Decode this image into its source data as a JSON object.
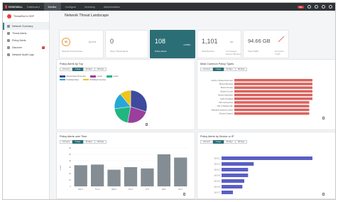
{
  "topbar": {
    "logo_text": "SONICWALL",
    "tabs": [
      {
        "label": "Dashboard",
        "active": false
      },
      {
        "label": "Monitor",
        "active": true
      },
      {
        "label": "Configure",
        "active": false
      },
      {
        "label": "Inventory",
        "active": false
      },
      {
        "label": "Administration",
        "active": false
      }
    ],
    "alert_count": "99+",
    "icons": [
      "bell-icon",
      "help-icon",
      "settings-icon",
      "user-icon"
    ]
  },
  "sidebar": {
    "header": "Threat/Bot in SDP",
    "items": [
      {
        "label": "Network Summary",
        "active": true,
        "icon": "summary-icon",
        "badge": ""
      },
      {
        "label": "Threat Alerts",
        "active": false,
        "icon": "alert-icon",
        "badge": ""
      },
      {
        "label": "Policy Alerts",
        "active": false,
        "icon": "policy-icon",
        "badge": ""
      },
      {
        "label": "Discover",
        "active": false,
        "icon": "discover-icon",
        "badge": "1"
      },
      {
        "label": "Network Audit Logs",
        "active": false,
        "icon": "logs-icon",
        "badge": ""
      }
    ]
  },
  "main": {
    "title": "Network Threat Landscape",
    "kpis": [
      {
        "value": "53",
        "label": "Network Threat Score",
        "trend": "-40.47%",
        "trend_label": "",
        "gauge": true,
        "selected": false
      },
      {
        "value": "0",
        "label": "Open Threat Alerts",
        "trend": "",
        "trend_label": "",
        "gauge": false,
        "selected": false
      },
      {
        "value": "108",
        "label": "Policy Alerts",
        "trend": "+9.85%",
        "trend_label": "",
        "gauge": false,
        "selected": true
      },
      {
        "value": "1,101",
        "label": "Total Devices",
        "trend": "0%",
        "trend_label": "Unmanaged Devices Blocked",
        "gauge": false,
        "selected": false
      },
      {
        "value": "94.66 GB",
        "label": "Total Traffic",
        "trend": "",
        "trend_label": "Encrypted Traffic",
        "gauge": false,
        "selected": false
      }
    ],
    "range_options": [
      "24 hours",
      "7 days",
      "30 days",
      "90 days"
    ],
    "range_selected": "7 days",
    "pie_panel": {
      "title": "Policy Alerts by Top",
      "legend": [
        {
          "name": "Ransomware Prevention",
          "color": "#3d4a9e"
        },
        {
          "name": "Level2",
          "color": "#9a3f9c"
        },
        {
          "name": "Level1",
          "color": "#23b57f"
        },
        {
          "name": "Prohibited Sites",
          "color": "#27a7d8"
        },
        {
          "name": "Prohibited Countries",
          "color": "#f0c419"
        }
      ],
      "slices": [
        {
          "name": "Ransomware Prevention",
          "value": 30,
          "color": "#3d4a9e"
        },
        {
          "name": "Level2",
          "value": 23,
          "color": "#9a3f9c"
        },
        {
          "name": "Level1",
          "value": 20,
          "color": "#23b57f"
        },
        {
          "name": "Prohibited Sites",
          "value": 16,
          "color": "#27a7d8"
        },
        {
          "name": "Prohibited Countries",
          "value": 11,
          "color": "#f0c419"
        }
      ]
    },
    "violations_panel": {
      "title": "Most Common Policy Types",
      "bar_color": "#d9645f",
      "categories": [
        "Activity in Bypass Mode Alert",
        "Blocked Browsing",
        "Blocked Service",
        "Blocked Country",
        "Blocked Application",
        "Traffic Prohibited",
        "P2P, Gaming Sites",
        "URL in Whitelist URL",
        "Application blocked by policy",
        "Blocked Category"
      ],
      "values": [
        98,
        98,
        98,
        98,
        98,
        98,
        94,
        94,
        94,
        94
      ]
    },
    "time_panel": {
      "title": "Policy Alerts over Time",
      "bar_color": "#858d94",
      "ylabel": "Count",
      "ylim": [
        0,
        60
      ],
      "yticks": [
        "0",
        "10",
        "20",
        "30",
        "40",
        "50",
        "60"
      ],
      "categories": [
        "Mon 1",
        "Tue 2",
        "Wed 3",
        "Thu 4",
        "Fri 5",
        "Sat 6",
        "Sun 7"
      ],
      "values": [
        33,
        34,
        26,
        30,
        28,
        50,
        45
      ]
    },
    "device_panel": {
      "title": "Policy Alerts by Device or IP",
      "bar_color": "#5a5fc4",
      "categories": [
        "10.0.0.1",
        "10.0.0.2",
        "10.0.0.3",
        "10.0.0.4",
        "10.0.0.5",
        "10.0.0.6",
        "10.0.0.7"
      ],
      "values": [
        48,
        17,
        14,
        14,
        12,
        11,
        6
      ]
    }
  },
  "chart_data": [
    {
      "type": "pie",
      "title": "Policy Alerts by Top",
      "categories": [
        "Ransomware Prevention",
        "Level2",
        "Level1",
        "Prohibited Sites",
        "Prohibited Countries"
      ],
      "values": [
        30,
        23,
        20,
        16,
        11
      ]
    },
    {
      "type": "bar",
      "title": "Most Common Policy Types",
      "categories": [
        "Activity in Bypass Mode Alert",
        "Blocked Browsing",
        "Blocked Service",
        "Blocked Country",
        "Blocked Application",
        "Traffic Prohibited",
        "P2P, Gaming Sites",
        "URL in Whitelist URL",
        "Application blocked by policy",
        "Blocked Category"
      ],
      "values": [
        98,
        98,
        98,
        98,
        98,
        98,
        94,
        94,
        94,
        94
      ]
    },
    {
      "type": "bar",
      "title": "Policy Alerts over Time",
      "ylabel": "Count",
      "ylim": [
        0,
        60
      ],
      "categories": [
        "Mon 1",
        "Tue 2",
        "Wed 3",
        "Thu 4",
        "Fri 5",
        "Sat 6",
        "Sun 7"
      ],
      "values": [
        33,
        34,
        26,
        30,
        28,
        50,
        45
      ]
    },
    {
      "type": "bar",
      "title": "Policy Alerts by Device or IP",
      "categories": [
        "10.0.0.1",
        "10.0.0.2",
        "10.0.0.3",
        "10.0.0.4",
        "10.0.0.5",
        "10.0.0.6",
        "10.0.0.7"
      ],
      "values": [
        48,
        17,
        14,
        14,
        12,
        11,
        6
      ]
    }
  ]
}
